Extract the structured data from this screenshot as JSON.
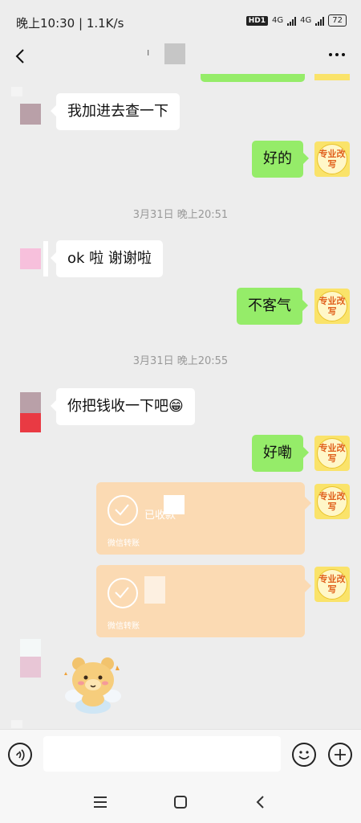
{
  "status_bar": {
    "time": "晚上10:30 | 1.1K/s",
    "hd": "HD1",
    "net1": "4G",
    "net2": "4G",
    "battery": "72"
  },
  "messages": [
    {
      "side": "right",
      "text": "",
      "partial": true
    },
    {
      "side": "left",
      "text": "我加进去查一下"
    },
    {
      "side": "right",
      "text": "好的"
    },
    {
      "timestamp": "3月31日 晚上20:51"
    },
    {
      "side": "left",
      "text": "ok 啦 谢谢啦"
    },
    {
      "side": "right",
      "text": "不客气"
    },
    {
      "timestamp": "3月31日 晚上20:55"
    },
    {
      "side": "left",
      "text": "你把钱收一下吧😁"
    },
    {
      "side": "right",
      "text": "好嘞"
    },
    {
      "side": "right",
      "type": "transfer",
      "status": "已收款",
      "label": "微信转账"
    },
    {
      "side": "right",
      "type": "transfer",
      "status": "",
      "label": "微信转账"
    },
    {
      "side": "left",
      "type": "sticker",
      "sticker": "bear-sticker"
    }
  ],
  "my_avatar_text": "专业改写",
  "input": {
    "placeholder": ""
  },
  "icons": {
    "back": "chevron-left-icon",
    "more": "more-icon",
    "voice": "voice-icon",
    "emoji": "emoji-icon",
    "plus": "plus-icon",
    "nav_menu": "menu-icon",
    "nav_home": "home-icon",
    "nav_back": "nav-back-icon"
  },
  "colors": {
    "background": "#ededed",
    "my_bubble": "#95ec69",
    "their_bubble": "#ffffff",
    "transfer_card": "#fbdab3",
    "my_avatar_bg": "#fae36a"
  }
}
